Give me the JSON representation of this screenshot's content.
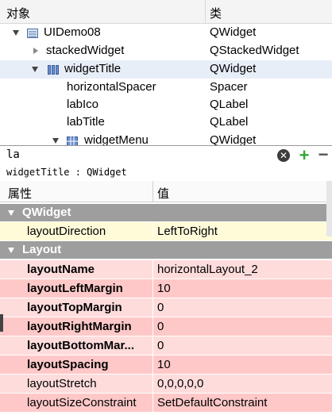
{
  "tree": {
    "col_object": "对象",
    "col_class": "类",
    "rows": [
      {
        "name": "UIDemo08",
        "cls": "QWidget"
      },
      {
        "name": "stackedWidget",
        "cls": "QStackedWidget"
      },
      {
        "name": "widgetTitle",
        "cls": "QWidget"
      },
      {
        "name": "horizontalSpacer",
        "cls": "Spacer"
      },
      {
        "name": "labIco",
        "cls": "QLabel"
      },
      {
        "name": "labTitle",
        "cls": "QLabel"
      },
      {
        "name": "widgetMenu",
        "cls": "QWidget"
      }
    ]
  },
  "filter": {
    "value": "la",
    "clear_label": "✕",
    "add_label": "+",
    "remove_label": "−"
  },
  "context": "widgetTitle : QWidget",
  "props": {
    "col_property": "属性",
    "col_value": "值",
    "group_qwidget": "QWidget",
    "group_layout": "Layout",
    "rows": [
      {
        "name": "layoutDirection",
        "value": "LeftToRight"
      },
      {
        "name": "layoutName",
        "value": "horizontalLayout_2"
      },
      {
        "name": "layoutLeftMargin",
        "value": "10"
      },
      {
        "name": "layoutTopMargin",
        "value": "0"
      },
      {
        "name": "layoutRightMargin",
        "value": "0"
      },
      {
        "name": "layoutBottomMar...",
        "value": "0"
      },
      {
        "name": "layoutSpacing",
        "value": "10"
      },
      {
        "name": "layoutStretch",
        "value": "0,0,0,0,0"
      },
      {
        "name": "layoutSizeConstraint",
        "value": "SetDefaultConstraint"
      }
    ]
  }
}
